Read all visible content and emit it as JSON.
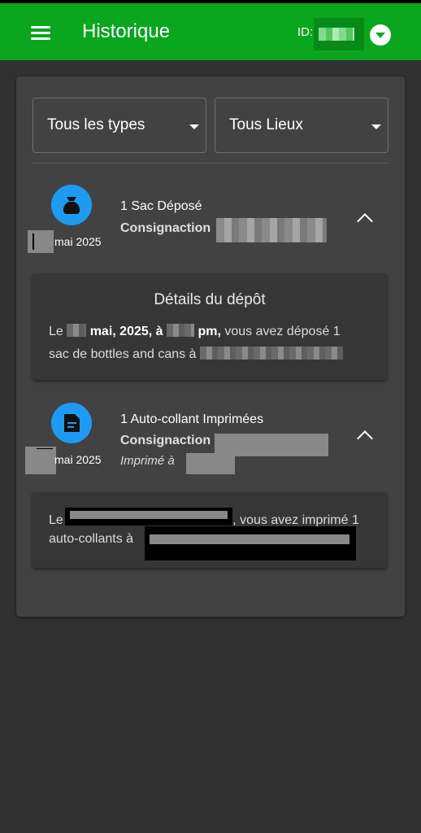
{
  "header": {
    "title": "Historique",
    "id_label": "ID:",
    "colors": {
      "bar": "#0aa61e",
      "id_box": "#078a17"
    }
  },
  "filters": {
    "types": {
      "selected": "Tous les types"
    },
    "lieux": {
      "selected": "Tous Lieux"
    }
  },
  "entries": [
    {
      "title": "1 Sac Déposé",
      "org": "Consignaction",
      "date": "mai 2025",
      "icon": "bag-icon",
      "detail": {
        "heading": "Détails du dépôt",
        "prefix": "Le",
        "date_text": "mai, 2025, à",
        "pm": "pm,",
        "line1_tail": "vous avez déposé 1",
        "line2": "sac de bottles and cans à"
      }
    },
    {
      "title": "1 Auto-collant Imprimées",
      "org": "Consignaction",
      "date": "mai 2025",
      "printed_at": "Imprimé à",
      "icon": "document-icon",
      "detail": {
        "prefix": "Le",
        "line1_tail": ", vous avez imprimé 1",
        "line2": "auto-collants à"
      }
    }
  ],
  "accent": "#1e9bf0"
}
